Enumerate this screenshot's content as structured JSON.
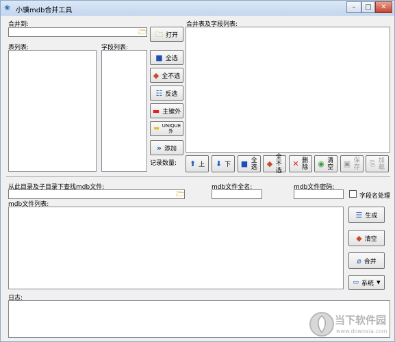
{
  "window": {
    "title": "小骥mdb合并工具",
    "minimize": "–",
    "maximize": "□",
    "close": "✕"
  },
  "labels": {
    "merge_to": "合并到:",
    "table_list": "表列表:",
    "field_list": "字段列表:",
    "merge_table_field_list": "合并表及字段列表:",
    "record_count": "记录数量:",
    "search_dir": "从此目录及子目录下查找mdb文件:",
    "mdb_fullname": "mdb文件全名:",
    "mdb_password": "mdb文件密码:",
    "field_name_process": "字段名处理",
    "mdb_file_list": "mdb文件列表:",
    "log": "日志:"
  },
  "buttons": {
    "open": "打开",
    "select_all": "全选",
    "select_none": "全不选",
    "invert": "反选",
    "except_pk": "主键外",
    "unique_except": "UNIQUE外",
    "add": "添加",
    "up": "上",
    "down": "下",
    "all_sel": "全选",
    "none_sel": "全不选",
    "delete": "删除",
    "clear": "清空",
    "save": "保存",
    "load": "加载",
    "generate": "生成",
    "clear2": "清空",
    "merge": "合并",
    "system": "系统"
  },
  "watermark": {
    "text": "当下软件园",
    "url": "www.downxia.com"
  }
}
